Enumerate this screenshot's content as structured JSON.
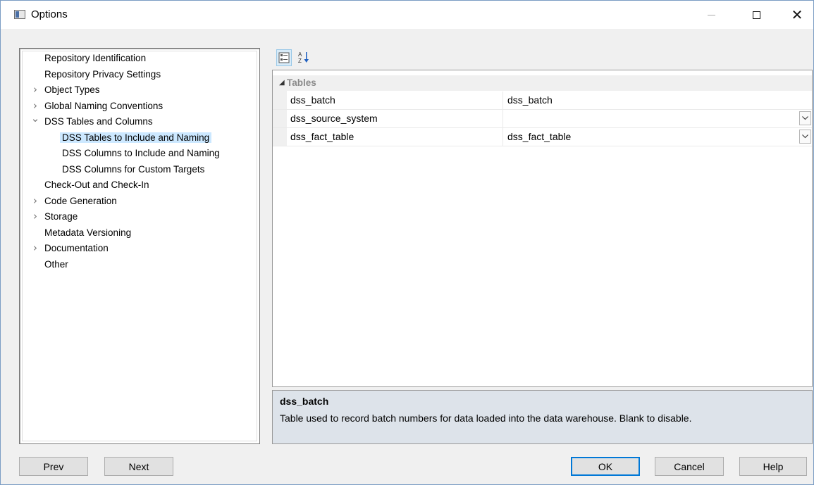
{
  "window": {
    "title": "Options"
  },
  "tree": {
    "items": [
      {
        "label": "Repository Identification",
        "level": 0,
        "expander": ""
      },
      {
        "label": "Repository Privacy Settings",
        "level": 0,
        "expander": ""
      },
      {
        "label": "Object Types",
        "level": 0,
        "expander": ">"
      },
      {
        "label": "Global Naming Conventions",
        "level": 0,
        "expander": ">"
      },
      {
        "label": "DSS Tables and Columns",
        "level": 0,
        "expander": "v"
      },
      {
        "label": "DSS Tables to Include and Naming",
        "level": 1,
        "expander": "",
        "selected": true
      },
      {
        "label": "DSS Columns to Include and Naming",
        "level": 1,
        "expander": ""
      },
      {
        "label": "DSS Columns for Custom Targets",
        "level": 1,
        "expander": ""
      },
      {
        "label": "Check-Out and Check-In",
        "level": 0,
        "expander": ""
      },
      {
        "label": "Code Generation",
        "level": 0,
        "expander": ">"
      },
      {
        "label": "Storage",
        "level": 0,
        "expander": ">"
      },
      {
        "label": "Metadata Versioning",
        "level": 0,
        "expander": ""
      },
      {
        "label": "Documentation",
        "level": 0,
        "expander": ">"
      },
      {
        "label": "Other",
        "level": 0,
        "expander": ""
      }
    ]
  },
  "toolbar": {
    "categorized_icon": "categorized-icon",
    "alphabetical_icon": "sort-az-icon",
    "alphabetical_glyph_top": "A",
    "alphabetical_glyph_bottom": "Z"
  },
  "grid": {
    "category": "Tables",
    "properties": [
      {
        "name": "dss_batch",
        "value": "dss_batch",
        "dropdown": false
      },
      {
        "name": "dss_source_system",
        "value": "",
        "dropdown": true
      },
      {
        "name": "dss_fact_table",
        "value": "dss_fact_table",
        "dropdown": true
      }
    ]
  },
  "description": {
    "title": "dss_batch",
    "text": "Table used to record batch numbers for data loaded into the data warehouse. Blank to disable."
  },
  "buttons": {
    "prev": "Prev",
    "next": "Next",
    "ok": "OK",
    "cancel": "Cancel",
    "help": "Help"
  },
  "colors": {
    "selection": "#cce8ff",
    "description_bg": "#dde3ea",
    "default_button_border": "#0078d7"
  }
}
